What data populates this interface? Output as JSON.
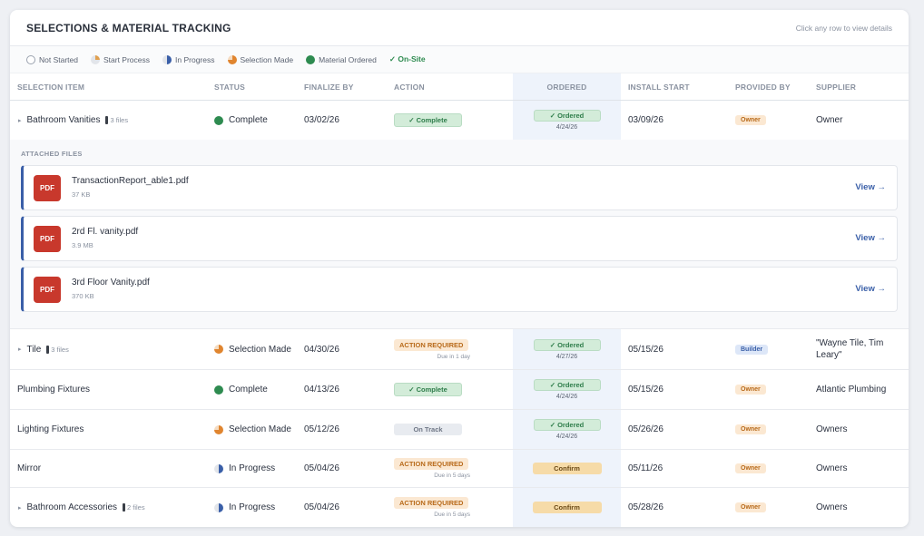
{
  "header": {
    "title": "SELECTIONS & MATERIAL TRACKING",
    "hint": "Click any row to view details"
  },
  "legend": [
    {
      "label": "Not Started",
      "status": "not-started"
    },
    {
      "label": "Start Process",
      "status": "start"
    },
    {
      "label": "In Progress",
      "status": "progress"
    },
    {
      "label": "Selection Made",
      "status": "selection"
    },
    {
      "label": "Material Ordered",
      "status": "ordered"
    },
    {
      "label": "✓ On-Site",
      "status": "onsite"
    }
  ],
  "columns": {
    "item": "SELECTION ITEM",
    "status": "STATUS",
    "finalize": "FINALIZE BY",
    "action": "ACTION",
    "ordered": "ORDERED",
    "install": "INSTALL START",
    "provided": "PROVIDED BY",
    "supplier": "SUPPLIER"
  },
  "rows": [
    {
      "caret": "▸",
      "name": "Bathroom Vanities",
      "files": "3 files",
      "status": "Complete",
      "finalize": "03/02/26",
      "action": "✓ Complete",
      "ordered": "✓ Ordered",
      "ordered_date": "4/24/26",
      "install": "03/09/26",
      "provided": "Owner",
      "supplier": "Owner"
    },
    {
      "caret": "▸",
      "name": "Tile",
      "files": "3 files",
      "status": "Selection Made",
      "finalize": "04/30/26",
      "action": "ACTION REQUIRED",
      "due": "Due in 1 day",
      "ordered": "✓ Ordered",
      "ordered_date": "4/27/26",
      "install": "05/15/26",
      "provided": "Builder",
      "supplier": "\"Wayne Tile, Tim Leary\""
    },
    {
      "name": "Plumbing Fixtures",
      "status": "Complete",
      "finalize": "04/13/26",
      "action": "✓ Complete",
      "ordered": "✓ Ordered",
      "ordered_date": "4/24/26",
      "install": "05/15/26",
      "provided": "Owner",
      "supplier": "Atlantic Plumbing"
    },
    {
      "name": "Lighting Fixtures",
      "status": "Selection Made",
      "finalize": "05/12/26",
      "action": "On Track",
      "ordered": "✓ Ordered",
      "ordered_date": "4/24/26",
      "install": "05/26/26",
      "provided": "Owner",
      "supplier": "Owners"
    },
    {
      "name": "Mirror",
      "status": "In Progress",
      "finalize": "05/04/26",
      "action": "ACTION REQUIRED",
      "due": "Due in 5 days",
      "ordered": "Confirm",
      "install": "05/11/26",
      "provided": "Owner",
      "supplier": "Owners"
    },
    {
      "caret": "▸",
      "name": "Bathroom Accessories",
      "files": "2 files",
      "status": "In Progress",
      "finalize": "05/04/26",
      "action": "ACTION REQUIRED",
      "due": "Due in 5 days",
      "ordered": "Confirm",
      "install": "05/28/26",
      "provided": "Owner",
      "supplier": "Owners"
    }
  ],
  "attached": {
    "label": "ATTACHED FILES",
    "badge": "PDF",
    "view": "View →",
    "files": [
      {
        "name": "TransactionReport_able1.pdf",
        "size": "37 KB"
      },
      {
        "name": "2rd Fl. vanity.pdf",
        "size": "3.9 MB"
      },
      {
        "name": "3rd Floor Vanity.pdf",
        "size": "370 KB"
      }
    ]
  },
  "colors": {
    "accent": "#3a5fa8",
    "complete": "#2e8b50",
    "warning": "#b86a1a",
    "pdf": "#c8382c"
  }
}
